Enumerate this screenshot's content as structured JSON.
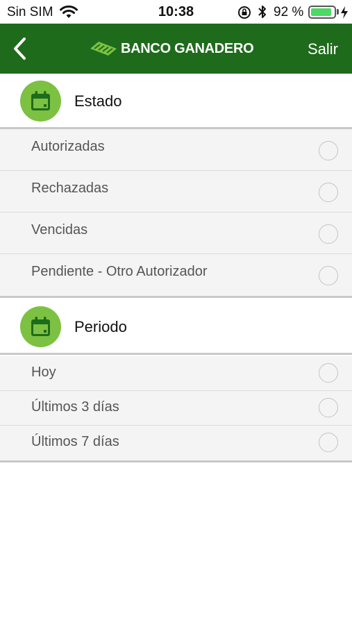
{
  "status_bar": {
    "carrier": "Sin SIM",
    "time": "10:38",
    "battery_percent": "92 %",
    "battery_level": 0.92,
    "icons": [
      "wifi-icon",
      "orientation-lock-icon",
      "bluetooth-icon",
      "battery-icon",
      "charging-icon"
    ]
  },
  "header": {
    "brand_name": "BANCO GANADERO",
    "logout_label": "Salir",
    "back_icon": "chevron-left-icon",
    "background_color": "#1e6b1c"
  },
  "sections": {
    "estado": {
      "title": "Estado",
      "icon": "calendar-icon",
      "options": [
        {
          "label": "Autorizadas",
          "selected": false
        },
        {
          "label": "Rechazadas",
          "selected": false
        },
        {
          "label": "Vencidas",
          "selected": false
        },
        {
          "label": "Pendiente - Otro Autorizador",
          "selected": false
        }
      ]
    },
    "periodo": {
      "title": "Periodo",
      "icon": "calendar-icon",
      "options": [
        {
          "label": "Hoy",
          "selected": false
        },
        {
          "label": "Últimos 3 días",
          "selected": false
        },
        {
          "label": "Últimos 7 días",
          "selected": false
        }
      ]
    }
  },
  "colors": {
    "accent_green": "#7cc142",
    "header_green": "#1e6b1c",
    "list_background": "#f4f4f4"
  }
}
